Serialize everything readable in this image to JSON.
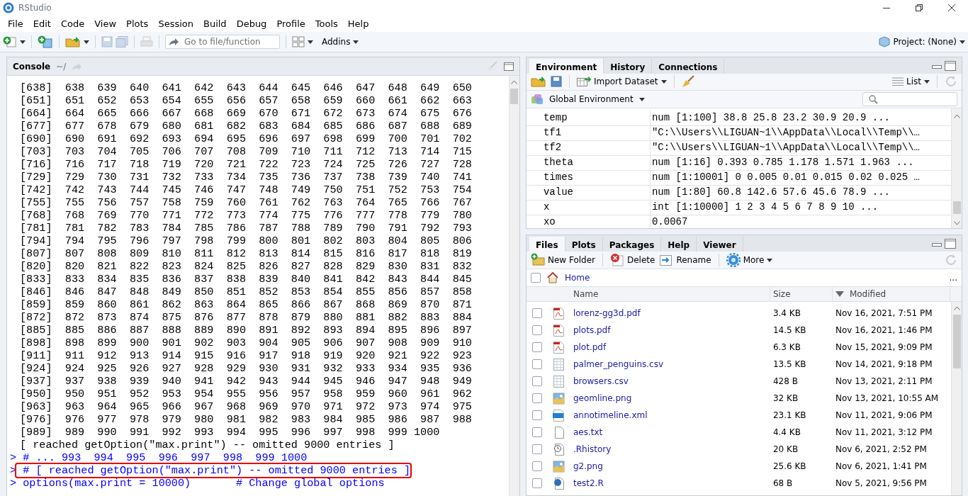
{
  "window": {
    "title": "RStudio"
  },
  "menu": [
    "File",
    "Edit",
    "Code",
    "View",
    "Plots",
    "Session",
    "Build",
    "Debug",
    "Profile",
    "Tools",
    "Help"
  ],
  "toolbar": {
    "search_placeholder": "Go to file/function",
    "addins": "Addins",
    "project": "Project: (None)"
  },
  "console": {
    "tab": "Console",
    "path": "~/",
    "lines": [
      {
        "kind": "output",
        "text": "[638]  638  639  640  641  642  643  644  645  646  647  648  649  650"
      },
      {
        "kind": "output",
        "text": "[651]  651  652  653  654  655  656  657  658  659  660  661  662  663"
      },
      {
        "kind": "output",
        "text": "[664]  664  665  666  667  668  669  670  671  672  673  674  675  676"
      },
      {
        "kind": "output",
        "text": "[677]  677  678  679  680  681  682  683  684  685  686  687  688  689"
      },
      {
        "kind": "output",
        "text": "[690]  690  691  692  693  694  695  696  697  698  699  700  701  702"
      },
      {
        "kind": "output",
        "text": "[703]  703  704  705  706  707  708  709  710  711  712  713  714  715"
      },
      {
        "kind": "output",
        "text": "[716]  716  717  718  719  720  721  722  723  724  725  726  727  728"
      },
      {
        "kind": "output",
        "text": "[729]  729  730  731  732  733  734  735  736  737  738  739  740  741"
      },
      {
        "kind": "output",
        "text": "[742]  742  743  744  745  746  747  748  749  750  751  752  753  754"
      },
      {
        "kind": "output",
        "text": "[755]  755  756  757  758  759  760  761  762  763  764  765  766  767"
      },
      {
        "kind": "output",
        "text": "[768]  768  769  770  771  772  773  774  775  776  777  778  779  780"
      },
      {
        "kind": "output",
        "text": "[781]  781  782  783  784  785  786  787  788  789  790  791  792  793"
      },
      {
        "kind": "output",
        "text": "[794]  794  795  796  797  798  799  800  801  802  803  804  805  806"
      },
      {
        "kind": "output",
        "text": "[807]  807  808  809  810  811  812  813  814  815  816  817  818  819"
      },
      {
        "kind": "output",
        "text": "[820]  820  821  822  823  824  825  826  827  828  829  830  831  832"
      },
      {
        "kind": "output",
        "text": "[833]  833  834  835  836  837  838  839  840  841  842  843  844  845"
      },
      {
        "kind": "output",
        "text": "[846]  846  847  848  849  850  851  852  853  854  855  856  857  858"
      },
      {
        "kind": "output",
        "text": "[859]  859  860  861  862  863  864  865  866  867  868  869  870  871"
      },
      {
        "kind": "output",
        "text": "[872]  872  873  874  875  876  877  878  879  880  881  882  883  884"
      },
      {
        "kind": "output",
        "text": "[885]  885  886  887  888  889  890  891  892  893  894  895  896  897"
      },
      {
        "kind": "output",
        "text": "[898]  898  899  900  901  902  903  904  905  906  907  908  909  910"
      },
      {
        "kind": "output",
        "text": "[911]  911  912  913  914  915  916  917  918  919  920  921  922  923"
      },
      {
        "kind": "output",
        "text": "[924]  924  925  926  927  928  929  930  931  932  933  934  935  936"
      },
      {
        "kind": "output",
        "text": "[937]  937  938  939  940  941  942  943  944  945  946  947  948  949"
      },
      {
        "kind": "output",
        "text": "[950]  950  951  952  953  954  955  956  957  958  959  960  961  962"
      },
      {
        "kind": "output",
        "text": "[963]  963  964  965  966  967  968  969  970  971  972  973  974  975"
      },
      {
        "kind": "output",
        "text": "[976]  976  977  978  979  980  981  982  983  984  985  986  987  988"
      },
      {
        "kind": "output",
        "text": "[989]  989  990  991  992  993  994  995  996  997  998  999 1000"
      },
      {
        "kind": "output",
        "text": "[ reached getOption(\"max.print\") -- omitted 9000 entries ]"
      },
      {
        "kind": "input",
        "prompt": ">",
        "text": "# ... 993  994  995  996  997  998  999 1000",
        "highlighted": false
      },
      {
        "kind": "input",
        "prompt": ">",
        "text": "# [ reached getOption(\"max.print\") -- omitted 9000 entries ]",
        "highlighted": true
      },
      {
        "kind": "input",
        "prompt": ">",
        "text": "options(max.print = 10000)       # Change global options",
        "highlighted": false
      }
    ]
  },
  "environment": {
    "tabs": [
      {
        "label": "Environment",
        "selected": true
      },
      {
        "label": "History",
        "selected": false
      },
      {
        "label": "Connections",
        "selected": false
      }
    ],
    "import": "Import Dataset",
    "view": "List",
    "scope": "Global Environment",
    "variables": [
      {
        "name": "temp",
        "value": "num [1:100] 38.8 25.8 23.2 30.9 20.9 ..."
      },
      {
        "name": "tf1",
        "value": "\"C:\\\\Users\\\\LIGUAN~1\\\\AppData\\\\Local\\\\Temp\\\\…"
      },
      {
        "name": "tf2",
        "value": "\"C:\\\\Users\\\\LIGUAN~1\\\\AppData\\\\Local\\\\Temp\\\\…"
      },
      {
        "name": "theta",
        "value": "num [1:16] 0.393 0.785 1.178 1.571 1.963 ..."
      },
      {
        "name": "times",
        "value": "num [1:10001] 0 0.005 0.01 0.015 0.02 0.025 …"
      },
      {
        "name": "value",
        "value": "num [1:80] 60.8 142.6 57.6 45.6 78.9 ..."
      },
      {
        "name": "x",
        "value": "int [1:10000] 1 2 3 4 5 6 7 8 9 10 ..."
      },
      {
        "name": "xo",
        "value": "0.0067"
      }
    ]
  },
  "files": {
    "tabs": [
      {
        "label": "Files",
        "selected": true
      },
      {
        "label": "Plots",
        "selected": false
      },
      {
        "label": "Packages",
        "selected": false
      },
      {
        "label": "Help",
        "selected": false
      },
      {
        "label": "Viewer",
        "selected": false
      }
    ],
    "actions": [
      {
        "kind": "new-folder",
        "label": "New Folder"
      },
      {
        "kind": "delete",
        "label": "Delete"
      },
      {
        "kind": "rename",
        "label": "Rename"
      },
      {
        "kind": "more",
        "label": "More"
      }
    ],
    "path": "Home",
    "path_menu": "...",
    "select_all_checked": false,
    "columns": [
      {
        "label": "Name",
        "sorted": false
      },
      {
        "label": "Size",
        "sorted": false
      },
      {
        "label": "Modified",
        "sorted": true
      }
    ],
    "rows": [
      {
        "kind": "pdf",
        "name": "lorenz-gg3d.pdf",
        "size": "3.4 KB",
        "modified": "Nov 16, 2021, 7:51 PM",
        "checked": false
      },
      {
        "kind": "pdf",
        "name": "plots.pdf",
        "size": "14.5 KB",
        "modified": "Nov 16, 2021, 1:46 PM",
        "checked": false
      },
      {
        "kind": "pdf",
        "name": "plot.pdf",
        "size": "6.3 KB",
        "modified": "Nov 15, 2021, 9:09 PM",
        "checked": false
      },
      {
        "kind": "csv",
        "name": "palmer_penguins.csv",
        "size": "13.5 KB",
        "modified": "Nov 14, 2021, 9:18 PM",
        "checked": false
      },
      {
        "kind": "csv",
        "name": "browsers.csv",
        "size": "428 B",
        "modified": "Nov 13, 2021, 2:11 PM",
        "checked": false
      },
      {
        "kind": "png",
        "name": "geomline.png",
        "size": "32 KB",
        "modified": "Nov 13, 2021, 10:55 AM",
        "checked": false
      },
      {
        "kind": "xml",
        "name": "annotimeline.xml",
        "size": "23.1 KB",
        "modified": "Nov 11, 2021, 9:06 PM",
        "checked": false
      },
      {
        "kind": "txt",
        "name": "aes.txt",
        "size": "4.4 KB",
        "modified": "Nov 11, 2021, 3:12 PM",
        "checked": false
      },
      {
        "kind": "history",
        "name": ".Rhistory",
        "size": "20 KB",
        "modified": "Nov 6, 2021, 2:52 PM",
        "checked": false
      },
      {
        "kind": "png",
        "name": "g2.png",
        "size": "25.6 KB",
        "modified": "Nov 6, 2021, 1:41 PM",
        "checked": false
      },
      {
        "kind": "r",
        "name": "test2.R",
        "size": "68 B",
        "modified": "Nov 5, 2021, 9:56 PM",
        "checked": false
      }
    ]
  }
}
